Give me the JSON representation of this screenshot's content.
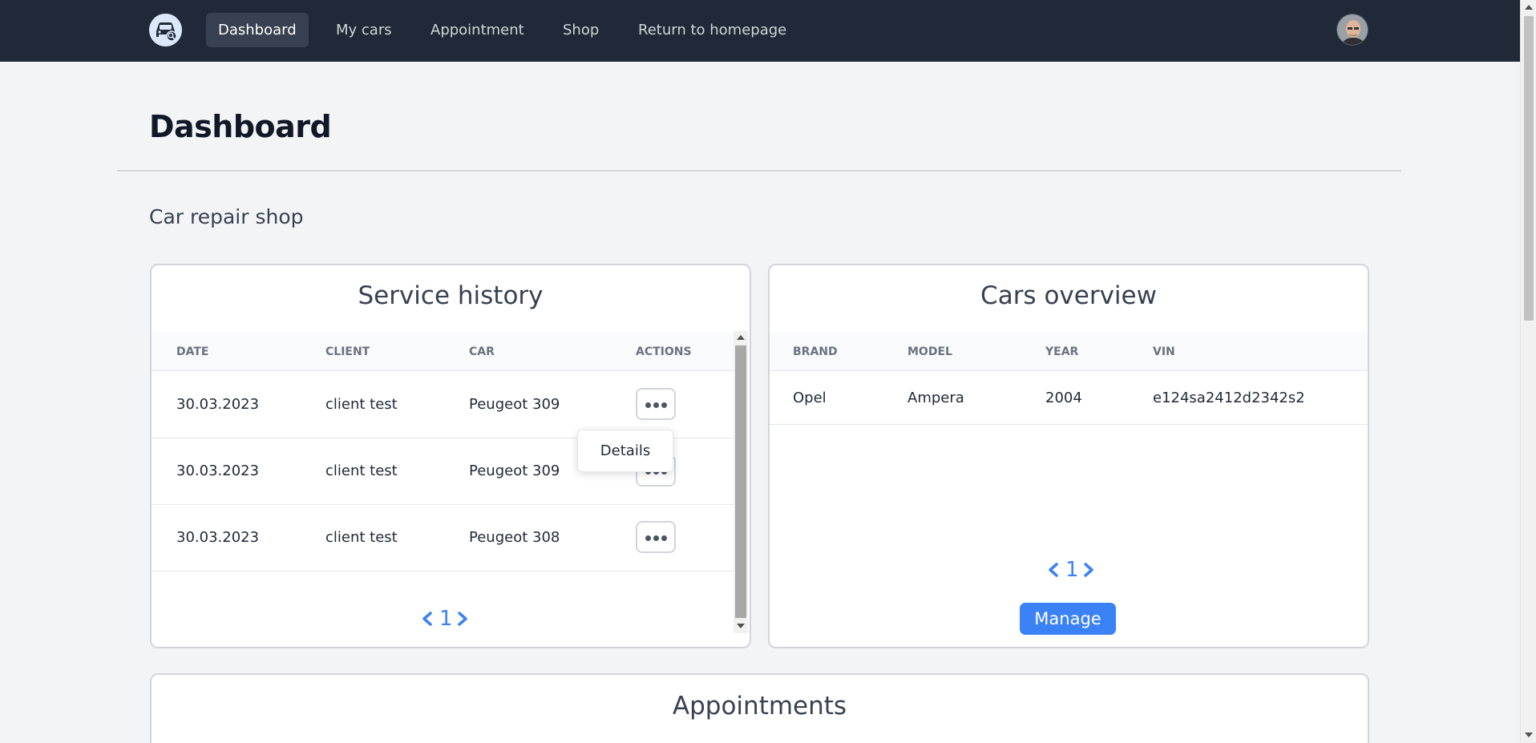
{
  "nav": {
    "items": [
      {
        "label": "Dashboard",
        "active": true
      },
      {
        "label": "My cars",
        "active": false
      },
      {
        "label": "Appointment",
        "active": false
      },
      {
        "label": "Shop",
        "active": false
      },
      {
        "label": "Return to homepage",
        "active": false
      }
    ],
    "logo_icon": "car-logo-icon",
    "avatar_icon": "user-avatar"
  },
  "page": {
    "title": "Dashboard",
    "section": "Car repair shop"
  },
  "service_history": {
    "title": "Service history",
    "columns": [
      "DATE",
      "CLIENT",
      "CAR",
      "ACTIONS"
    ],
    "rows": [
      {
        "date": "30.03.2023",
        "client": "client test",
        "car": "Peugeot 309"
      },
      {
        "date": "30.03.2023",
        "client": "client test",
        "car": "Peugeot 309"
      },
      {
        "date": "30.03.2023",
        "client": "client test",
        "car": "Peugeot 308"
      }
    ],
    "dropdown_item": "Details",
    "page": "1"
  },
  "cars_overview": {
    "title": "Cars overview",
    "columns": [
      "BRAND",
      "MODEL",
      "YEAR",
      "VIN"
    ],
    "rows": [
      {
        "brand": "Opel",
        "model": "Ampera",
        "year": "2004",
        "vin": "e124sa2412d2342s2"
      }
    ],
    "page": "1",
    "manage_label": "Manage"
  },
  "appointments": {
    "title": "Appointments"
  },
  "colors": {
    "nav_bg": "#1f2937",
    "accent": "#3b82f6",
    "page_bg": "#f3f4f6"
  }
}
